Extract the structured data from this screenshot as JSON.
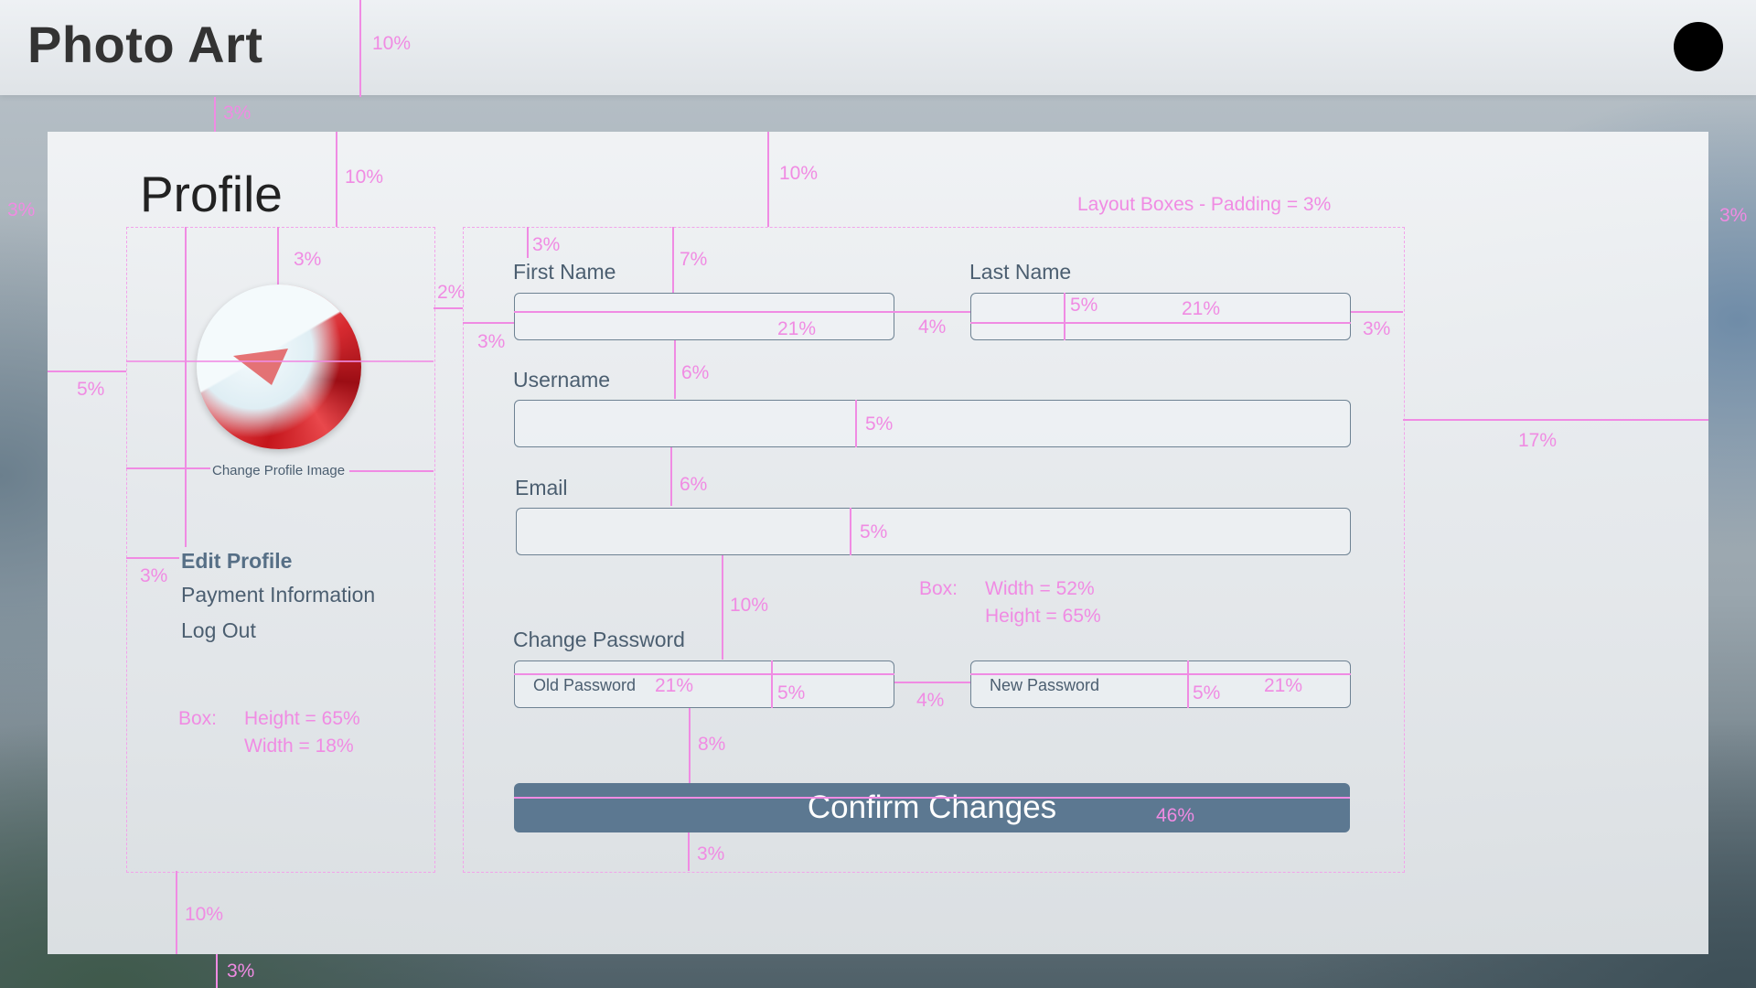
{
  "app": {
    "title": "Photo Art"
  },
  "header": {
    "user_avatar_icon": "user-avatar-dot"
  },
  "page": {
    "heading": "Profile"
  },
  "sidebar": {
    "change_image_label": "Change Profile Image",
    "menu": [
      {
        "label": "Edit Profile",
        "active": true
      },
      {
        "label": "Payment Information",
        "active": false
      },
      {
        "label": "Log Out",
        "active": false
      }
    ],
    "box_note": {
      "prefix": "Box:",
      "line1": "Height = 65%",
      "line2": "Width = 18%"
    }
  },
  "form": {
    "first_name": {
      "label": "First Name",
      "value": ""
    },
    "last_name": {
      "label": "Last Name",
      "value": ""
    },
    "username": {
      "label": "Username",
      "value": ""
    },
    "email": {
      "label": "Email",
      "value": ""
    },
    "change_password": {
      "label": "Change Password",
      "old_placeholder": "Old Password",
      "new_placeholder": "New Password"
    },
    "confirm_label": "Confirm Changes",
    "box_note": {
      "prefix": "Box:",
      "line1": "Width = 52%",
      "line2": "Height = 65%"
    },
    "layout_note": "Layout Boxes - Padding = 3%"
  },
  "annotations": {
    "p10": "10%",
    "p3": "3%",
    "p2": "2%",
    "p5": "5%",
    "p7": "7%",
    "p6": "6%",
    "p21": "21%",
    "p4": "4%",
    "p8": "8%",
    "p17": "17%",
    "p46": "46%"
  },
  "colors": {
    "accent": "#5c7891",
    "guide": "#f08be3",
    "text": "#4b5e70"
  }
}
